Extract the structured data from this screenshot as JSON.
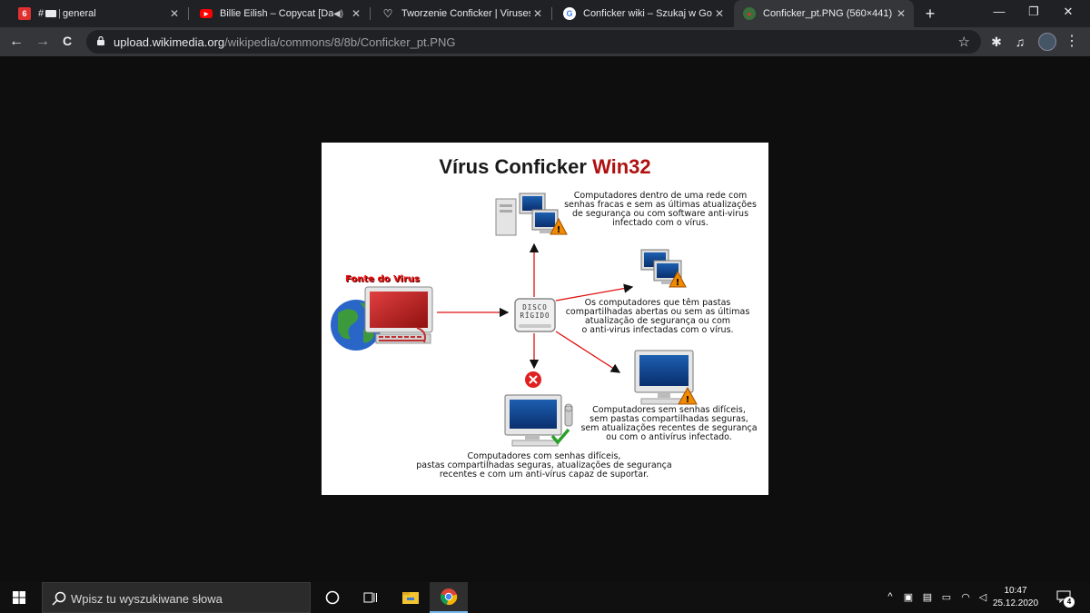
{
  "browser": {
    "tabs": [
      {
        "title": "general",
        "icon": "slack-discord-icon",
        "close": "✕"
      },
      {
        "title": "Billie Eilish – Copycat [Day",
        "icon": "youtube-icon",
        "close": "✕"
      },
      {
        "title": "Tworzenie Conficker | Viruses W",
        "icon": "heart-icon",
        "close": "✕"
      },
      {
        "title": "Conficker wiki – Szukaj w Goog",
        "icon": "google-icon",
        "close": "✕"
      },
      {
        "title": "Conficker_pt.PNG (560×441)",
        "icon": "wikimedia-icon",
        "close": "✕",
        "active": true
      }
    ],
    "tab1_prefix": "#",
    "new_tab": "+",
    "window": {
      "minimize": "—",
      "restore": "❐",
      "close": "✕"
    },
    "nav": {
      "back": "←",
      "forward": "→",
      "reload": "C"
    },
    "url_host": "upload.wikimedia.org",
    "url_path": "/wikipedia/commons/8/8b/Conficker_pt.PNG",
    "bookmark_star": "☆",
    "extensions": {
      "puzzle": "✱",
      "media": "♫",
      "menu": "⋮"
    }
  },
  "diagram": {
    "title_main": "Vírus Conficker",
    "title_red": "Win32",
    "source_label": "Fonte do Virus",
    "disk_label_1": "DISCO",
    "disk_label_2": "RÍGIDO",
    "caption_network": [
      "Computadores dentro de uma rede com",
      "senhas fracas e sem as últimas atualizações",
      "de segurança ou com software anti-virus",
      "infectado com o vírus."
    ],
    "caption_shared": [
      "Os computadores que têm pastas",
      "compartilhadas abertas ou sem as últimas",
      "atualização de segurança ou com",
      "o anti-virus infectadas com o vírus."
    ],
    "caption_strong": [
      "Computadores sem senhas difíceis,",
      "sem pastas compartilhadas seguras,",
      "sem atualizações recentes de segurança",
      "ou com o antivírus infectado."
    ],
    "caption_safe": [
      "Computadores com senhas difíceis,",
      "pastas compartilhadas seguras, atualizações de segurança",
      "recentes e com um anti-vírus capaz de suportar."
    ],
    "colors": {
      "arrow_red": "#e01010",
      "title_red": "#b01010",
      "warning": "#f08a00",
      "blocked": "#e02020",
      "ok_green": "#2aa02a"
    }
  },
  "taskbar": {
    "search_placeholder": "Wpisz tu wyszukiwane słowa",
    "icons": [
      "windows-start-icon",
      "cortana-icon",
      "task-view-icon",
      "file-explorer-icon",
      "chrome-icon"
    ],
    "tray_chevron": "^",
    "clock_time": "10:47",
    "clock_date": "25.12.2020",
    "notification_count": "4"
  }
}
